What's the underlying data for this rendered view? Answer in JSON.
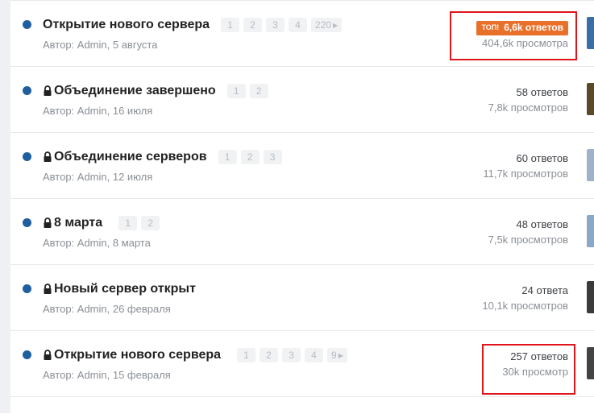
{
  "threads": [
    {
      "locked": false,
      "title": "Открытие нового сервера",
      "pages": [
        "1",
        "2",
        "3",
        "4",
        "220"
      ],
      "last_page_arrow": true,
      "author_meta": "Автор: Admin, 5 августа",
      "top_badge": {
        "label": "ТОП!",
        "value": "6,6k ответов"
      },
      "replies": "",
      "views": "404,6k просмотра",
      "avatar_color": "#3a6ea5"
    },
    {
      "locked": true,
      "title": "Объединение завершено",
      "pages": [
        "1",
        "2"
      ],
      "last_page_arrow": false,
      "author_meta": "Автор: Admin, 16 июля",
      "replies": "58 ответов",
      "views": "7,8k просмотров",
      "avatar_color": "#5a4a2a"
    },
    {
      "locked": true,
      "title": "Объединение серверов",
      "pages": [
        "1",
        "2",
        "3"
      ],
      "last_page_arrow": false,
      "author_meta": "Автор: Admin, 12 июля",
      "replies": "60 ответов",
      "views": "11,7k просмотров",
      "avatar_color": "#9fb3c8"
    },
    {
      "locked": true,
      "title": "8 марта",
      "pages": [
        "1",
        "2"
      ],
      "last_page_arrow": false,
      "author_meta": "Автор: Admin, 8 марта",
      "replies": "48 ответов",
      "views": "7,5k просмотров",
      "avatar_color": "#8aa9c9"
    },
    {
      "locked": true,
      "title": "Новый сервер открыт",
      "pages": [],
      "last_page_arrow": false,
      "author_meta": "Автор: Admin, 26 февраля",
      "replies": "24 ответа",
      "views": "10,1k просмотров",
      "avatar_color": "#3b3b3b"
    },
    {
      "locked": true,
      "title": "Открытие нового сервера",
      "pages": [
        "1",
        "2",
        "3",
        "4",
        "9"
      ],
      "last_page_arrow": true,
      "author_meta": "Автор: Admin, 15 февраля",
      "replies": "257 ответов",
      "views": "30k просмотр",
      "avatar_color": "#444444"
    }
  ],
  "colors": {
    "unread_dot": "#1f5f9f",
    "top_badge": "#e8702a",
    "highlight_box": "#e0141b"
  },
  "icons": {
    "lock": "lock-icon",
    "page_arrow": "triangle-right-icon"
  }
}
